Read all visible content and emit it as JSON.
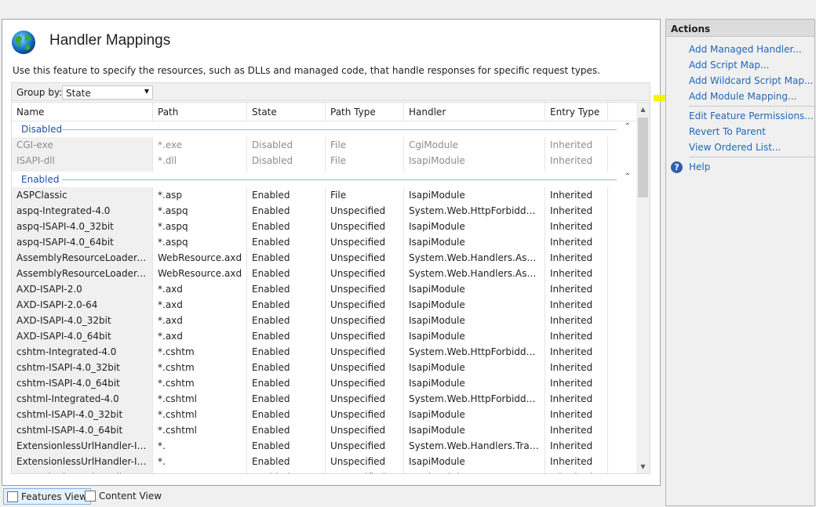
{
  "page": {
    "title": "Handler Mappings",
    "description": "Use this feature to specify the resources, such as DLLs and managed code, that handle responses for specific request types."
  },
  "groupby": {
    "label": "Group by:",
    "value": "State"
  },
  "columns": [
    "Name",
    "Path",
    "State",
    "Path Type",
    "Handler",
    "Entry Type"
  ],
  "groups": [
    {
      "label": "Disabled",
      "rows": [
        [
          "CGI-exe",
          "*.exe",
          "Disabled",
          "File",
          "CgiModule",
          "Inherited"
        ],
        [
          "ISAPI-dll",
          "*.dll",
          "Disabled",
          "File",
          "IsapiModule",
          "Inherited"
        ]
      ]
    },
    {
      "label": "Enabled",
      "rows": [
        [
          "ASPClassic",
          "*.asp",
          "Enabled",
          "File",
          "IsapiModule",
          "Inherited"
        ],
        [
          "aspq-Integrated-4.0",
          "*.aspq",
          "Enabled",
          "Unspecified",
          "System.Web.HttpForbiddenH...",
          "Inherited"
        ],
        [
          "aspq-ISAPI-4.0_32bit",
          "*.aspq",
          "Enabled",
          "Unspecified",
          "IsapiModule",
          "Inherited"
        ],
        [
          "aspq-ISAPI-4.0_64bit",
          "*.aspq",
          "Enabled",
          "Unspecified",
          "IsapiModule",
          "Inherited"
        ],
        [
          "AssemblyResourceLoader-Inte...",
          "WebResource.axd",
          "Enabled",
          "Unspecified",
          "System.Web.Handlers.Assem...",
          "Inherited"
        ],
        [
          "AssemblyResourceLoader-Inte...",
          "WebResource.axd",
          "Enabled",
          "Unspecified",
          "System.Web.Handlers.Assem...",
          "Inherited"
        ],
        [
          "AXD-ISAPI-2.0",
          "*.axd",
          "Enabled",
          "Unspecified",
          "IsapiModule",
          "Inherited"
        ],
        [
          "AXD-ISAPI-2.0-64",
          "*.axd",
          "Enabled",
          "Unspecified",
          "IsapiModule",
          "Inherited"
        ],
        [
          "AXD-ISAPI-4.0_32bit",
          "*.axd",
          "Enabled",
          "Unspecified",
          "IsapiModule",
          "Inherited"
        ],
        [
          "AXD-ISAPI-4.0_64bit",
          "*.axd",
          "Enabled",
          "Unspecified",
          "IsapiModule",
          "Inherited"
        ],
        [
          "cshtm-Integrated-4.0",
          "*.cshtm",
          "Enabled",
          "Unspecified",
          "System.Web.HttpForbiddenH...",
          "Inherited"
        ],
        [
          "cshtm-ISAPI-4.0_32bit",
          "*.cshtm",
          "Enabled",
          "Unspecified",
          "IsapiModule",
          "Inherited"
        ],
        [
          "cshtm-ISAPI-4.0_64bit",
          "*.cshtm",
          "Enabled",
          "Unspecified",
          "IsapiModule",
          "Inherited"
        ],
        [
          "cshtml-Integrated-4.0",
          "*.cshtml",
          "Enabled",
          "Unspecified",
          "System.Web.HttpForbiddenH...",
          "Inherited"
        ],
        [
          "cshtml-ISAPI-4.0_32bit",
          "*.cshtml",
          "Enabled",
          "Unspecified",
          "IsapiModule",
          "Inherited"
        ],
        [
          "cshtml-ISAPI-4.0_64bit",
          "*.cshtml",
          "Enabled",
          "Unspecified",
          "IsapiModule",
          "Inherited"
        ],
        [
          "ExtensionlessUrlHandler-Integ...",
          "*.",
          "Enabled",
          "Unspecified",
          "System.Web.Handlers.Transfe...",
          "Inherited"
        ],
        [
          "ExtensionlessUrlHandler-ISAPI...",
          "*.",
          "Enabled",
          "Unspecified",
          "IsapiModule",
          "Inherited"
        ],
        [
          "ExtensionlessUrlHandler-ISAPI...",
          "*.",
          "Enabled",
          "Unspecified",
          "IsapiModule",
          "Inherited"
        ]
      ]
    }
  ],
  "actions": {
    "title": "Actions",
    "items": [
      "Add Managed Handler...",
      "Add Script Map...",
      "Add Wildcard Script Map...",
      "Add Module Mapping...",
      "Edit Feature Permissions...",
      "Revert To Parent",
      "View Ordered List...",
      "Help"
    ]
  },
  "views": {
    "features": "Features View",
    "content": "Content View"
  },
  "icons": {
    "globe": "globe-icon",
    "help": "help-icon",
    "arrow": "yellow-arrow-icon",
    "features_view": "features-view-icon",
    "content_view": "content-view-icon"
  },
  "colors": {
    "link": "#1f67b8",
    "group": "#1f4fa7",
    "highlight_arrow": "#f5f500"
  }
}
